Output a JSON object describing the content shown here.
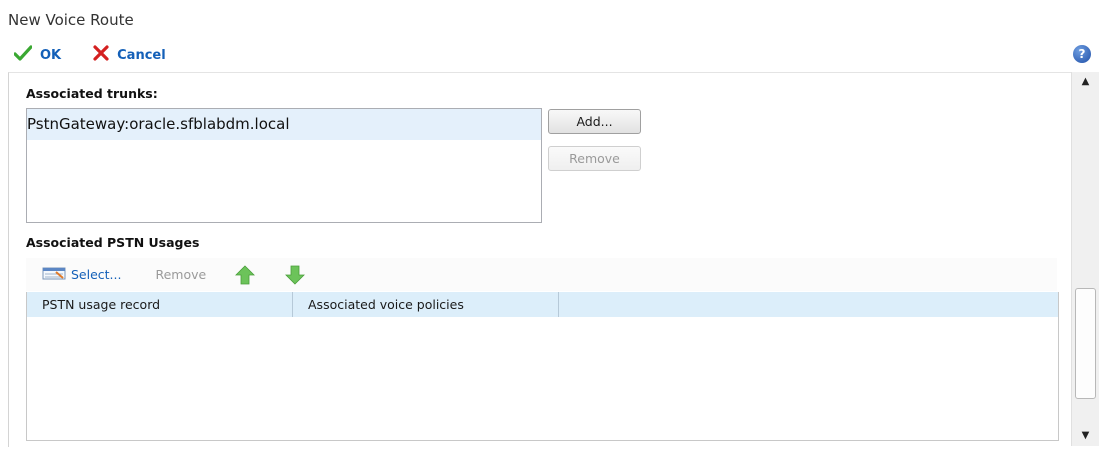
{
  "window": {
    "title": "New Voice Route"
  },
  "toolbar": {
    "ok_label": "OK",
    "cancel_label": "Cancel"
  },
  "help": {
    "glyph": "?"
  },
  "trunks": {
    "label": "Associated trunks:",
    "items": [
      "PstnGateway:oracle.sfblabdm.local"
    ],
    "add_label": "Add...",
    "remove_label": "Remove"
  },
  "pstn": {
    "label": "Associated PSTN Usages",
    "select_label": "Select...",
    "remove_label": "Remove",
    "columns": [
      "PSTN usage record",
      "Associated voice policies",
      ""
    ]
  },
  "colors": {
    "accent": "#1460b8",
    "selection": "#e4f0fb",
    "header": "#dceefa",
    "ok": "#3aa832",
    "cancel": "#d42020",
    "arrow": "#6cc35a"
  },
  "icons": [
    "check-icon",
    "x-icon",
    "help-icon",
    "select-list-icon",
    "arrow-up-icon",
    "arrow-down-icon"
  ]
}
